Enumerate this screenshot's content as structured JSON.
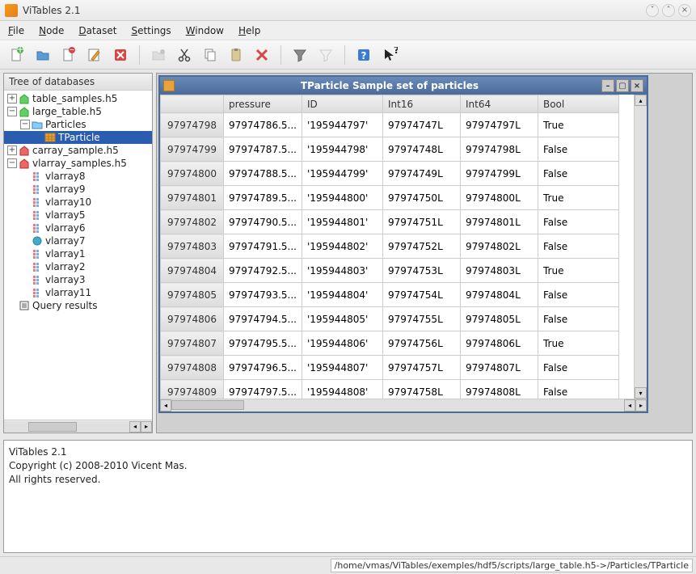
{
  "window": {
    "title": "ViTables 2.1"
  },
  "menu": {
    "file": "File",
    "node": "Node",
    "dataset": "Dataset",
    "settings": "Settings",
    "window": "Window",
    "help": "Help"
  },
  "tree": {
    "header": "Tree of databases",
    "items": [
      {
        "depth": 0,
        "expander": "+",
        "icon": "file-g",
        "label": "table_samples.h5",
        "sel": false
      },
      {
        "depth": 0,
        "expander": "-",
        "icon": "file-g",
        "label": "large_table.h5",
        "sel": false
      },
      {
        "depth": 1,
        "expander": "-",
        "icon": "folder",
        "label": "Particles",
        "sel": false
      },
      {
        "depth": 2,
        "expander": "",
        "icon": "grid",
        "label": "TParticle",
        "sel": true
      },
      {
        "depth": 0,
        "expander": "+",
        "icon": "file-r",
        "label": "carray_sample.h5",
        "sel": false
      },
      {
        "depth": 0,
        "expander": "-",
        "icon": "file-r",
        "label": "vlarray_samples.h5",
        "sel": false
      },
      {
        "depth": 1,
        "expander": "",
        "icon": "arr",
        "label": "vlarray8",
        "sel": false
      },
      {
        "depth": 1,
        "expander": "",
        "icon": "arr",
        "label": "vlarray9",
        "sel": false
      },
      {
        "depth": 1,
        "expander": "",
        "icon": "arr",
        "label": "vlarray10",
        "sel": false
      },
      {
        "depth": 1,
        "expander": "",
        "icon": "arr",
        "label": "vlarray5",
        "sel": false
      },
      {
        "depth": 1,
        "expander": "",
        "icon": "arr",
        "label": "vlarray6",
        "sel": false
      },
      {
        "depth": 1,
        "expander": "",
        "icon": "blue",
        "label": "vlarray7",
        "sel": false
      },
      {
        "depth": 1,
        "expander": "",
        "icon": "arr",
        "label": "vlarray1",
        "sel": false
      },
      {
        "depth": 1,
        "expander": "",
        "icon": "arr",
        "label": "vlarray2",
        "sel": false
      },
      {
        "depth": 1,
        "expander": "",
        "icon": "arr",
        "label": "vlarray3",
        "sel": false
      },
      {
        "depth": 1,
        "expander": "",
        "icon": "arr",
        "label": "vlarray11",
        "sel": false
      },
      {
        "depth": 0,
        "expander": "",
        "icon": "query",
        "label": "Query results",
        "sel": false
      }
    ]
  },
  "subwindow": {
    "title": "TParticle Sample set of particles"
  },
  "table": {
    "columns": [
      "pressure",
      "ID",
      "Int16",
      "Int64",
      "Bool"
    ],
    "rows": [
      {
        "hdr": "97974798",
        "cells": [
          "97974786.5...",
          "'195944797'",
          "97974747L",
          "97974797L",
          "True"
        ]
      },
      {
        "hdr": "97974799",
        "cells": [
          "97974787.5...",
          "'195944798'",
          "97974748L",
          "97974798L",
          "False"
        ]
      },
      {
        "hdr": "97974800",
        "cells": [
          "97974788.5...",
          "'195944799'",
          "97974749L",
          "97974799L",
          "False"
        ]
      },
      {
        "hdr": "97974801",
        "cells": [
          "97974789.5...",
          "'195944800'",
          "97974750L",
          "97974800L",
          "True"
        ]
      },
      {
        "hdr": "97974802",
        "cells": [
          "97974790.5...",
          "'195944801'",
          "97974751L",
          "97974801L",
          "False"
        ]
      },
      {
        "hdr": "97974803",
        "cells": [
          "97974791.5...",
          "'195944802'",
          "97974752L",
          "97974802L",
          "False"
        ]
      },
      {
        "hdr": "97974804",
        "cells": [
          "97974792.5...",
          "'195944803'",
          "97974753L",
          "97974803L",
          "True"
        ]
      },
      {
        "hdr": "97974805",
        "cells": [
          "97974793.5...",
          "'195944804'",
          "97974754L",
          "97974804L",
          "False"
        ]
      },
      {
        "hdr": "97974806",
        "cells": [
          "97974794.5...",
          "'195944805'",
          "97974755L",
          "97974805L",
          "False"
        ]
      },
      {
        "hdr": "97974807",
        "cells": [
          "97974795.5...",
          "'195944806'",
          "97974756L",
          "97974806L",
          "True"
        ]
      },
      {
        "hdr": "97974808",
        "cells": [
          "97974796.5...",
          "'195944807'",
          "97974757L",
          "97974807L",
          "False"
        ]
      },
      {
        "hdr": "97974809",
        "cells": [
          "97974797.5...",
          "'195944808'",
          "97974758L",
          "97974808L",
          "False"
        ]
      }
    ]
  },
  "log": {
    "line1": "ViTables 2.1",
    "line2": "Copyright (c) 2008-2010 Vicent Mas.",
    "line3": "All rights reserved."
  },
  "status": {
    "path": "/home/vmas/ViTables/exemples/hdf5/scripts/large_table.h5->/Particles/TParticle"
  }
}
